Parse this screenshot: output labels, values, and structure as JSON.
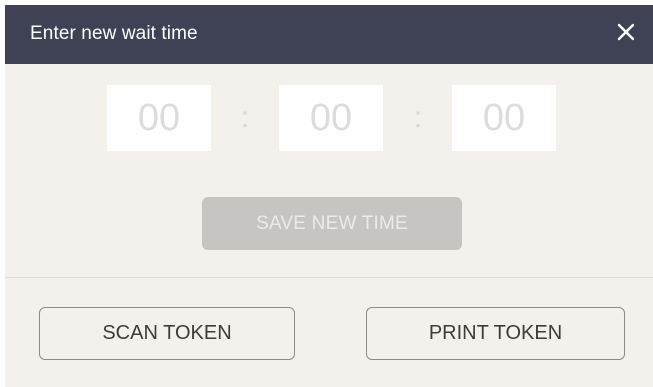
{
  "header": {
    "title": "Enter new wait time",
    "close_icon": "close-icon"
  },
  "time": {
    "hours": "00",
    "minutes": "00",
    "seconds": "00",
    "separator": ":"
  },
  "actions": {
    "save_label": "SAVE NEW TIME",
    "scan_label": "SCAN TOKEN",
    "print_label": "PRINT TOKEN"
  },
  "colors": {
    "header_bg": "#3f4254",
    "dialog_bg": "#f4f1ec",
    "save_disabled_bg": "#c7c5c1"
  }
}
